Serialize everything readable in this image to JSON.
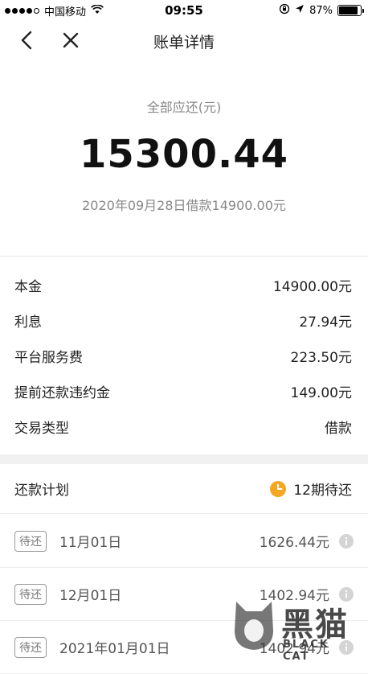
{
  "status_bar": {
    "carrier": "中国移动",
    "time": "09:55",
    "battery": "87%",
    "battery_level": 0.87
  },
  "nav": {
    "title": "账单详情"
  },
  "summary": {
    "label": "全部应还(元)",
    "amount": "15300.44",
    "subtitle": "2020年09月28日借款14900.00元"
  },
  "details": [
    {
      "label": "本金",
      "value": "14900.00元"
    },
    {
      "label": "利息",
      "value": "27.94元"
    },
    {
      "label": "平台服务费",
      "value": "223.50元"
    },
    {
      "label": "提前还款违约金",
      "value": "149.00元"
    },
    {
      "label": "交易类型",
      "value": "借款"
    }
  ],
  "plan": {
    "title": "还款计划",
    "status": "12期待还",
    "status_color": "#f5a623"
  },
  "schedule": [
    {
      "tag": "待还",
      "date": "11月01日",
      "amount": "1626.44元"
    },
    {
      "tag": "待还",
      "date": "12月01日",
      "amount": "1402.94元"
    },
    {
      "tag": "待还",
      "date": "2021年01月01日",
      "amount": "1402.94元"
    }
  ],
  "watermark": {
    "text": "黑猫",
    "sub": "BLACK CAT"
  }
}
